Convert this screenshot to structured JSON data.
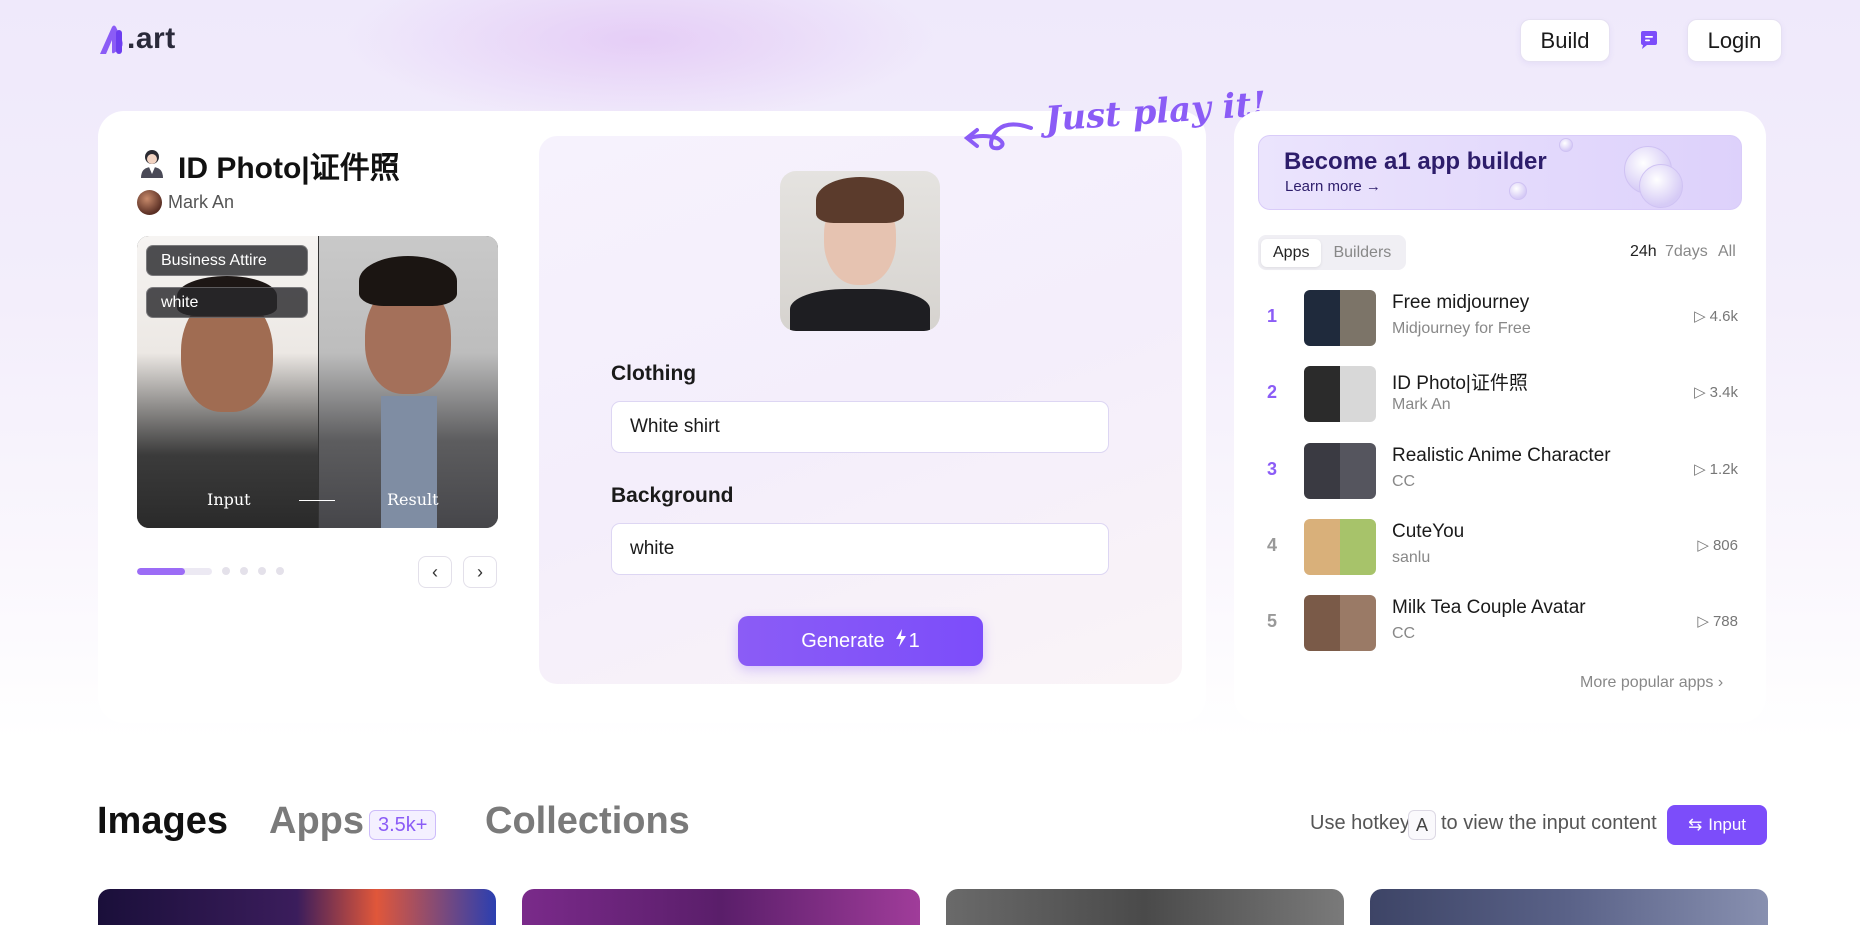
{
  "header": {
    "logo_text": ".art",
    "build_label": "Build",
    "login_label": "Login"
  },
  "featured_app": {
    "title": "ID Photo|证件照",
    "author": "Mark An",
    "chips": [
      "Business Attire",
      "white"
    ],
    "input_label": "Input",
    "result_label": "Result",
    "carousel": {
      "active_index": 0,
      "total": 5,
      "progress": 0.64
    },
    "tagline": "Just play it!",
    "form": {
      "clothing_label": "Clothing",
      "clothing_value": "White shirt",
      "background_label": "Background",
      "background_value": "white",
      "generate_label": "Generate",
      "generate_cost": "1"
    }
  },
  "sidebar": {
    "banner_title": "Become a1 app builder",
    "banner_link": "Learn more →",
    "tabs": [
      "Apps",
      "Builders"
    ],
    "active_tab": "Apps",
    "ranges": [
      "24h",
      "7days",
      "All"
    ],
    "active_range": "24h",
    "popular_apps": [
      {
        "rank": "1",
        "name": "Free midjourney",
        "sub": "Midjourney for Free",
        "count": "4.6k"
      },
      {
        "rank": "2",
        "name": "ID Photo|证件照",
        "sub": "Mark An",
        "count": "3.4k"
      },
      {
        "rank": "3",
        "name": "Realistic Anime Character",
        "sub": "CC",
        "count": "1.2k"
      },
      {
        "rank": "4",
        "name": "CuteYou",
        "sub": "sanlu",
        "count": "806"
      },
      {
        "rank": "5",
        "name": "Milk Tea Couple Avatar",
        "sub": "CC",
        "count": "788"
      }
    ],
    "more_label": "More popular apps"
  },
  "bottom": {
    "tabs": [
      "Images",
      "Apps",
      "Collections"
    ],
    "active_tab": "Images",
    "apps_badge": "3.5k+",
    "hint_before": "Use hotkey",
    "hotkey": "A",
    "hint_after": "to view the input content",
    "input_button": "Input"
  },
  "colors": {
    "accent": "#8b5cf6",
    "accent_dark": "#7c4dfa",
    "banner_text": "#2d1d6b"
  }
}
